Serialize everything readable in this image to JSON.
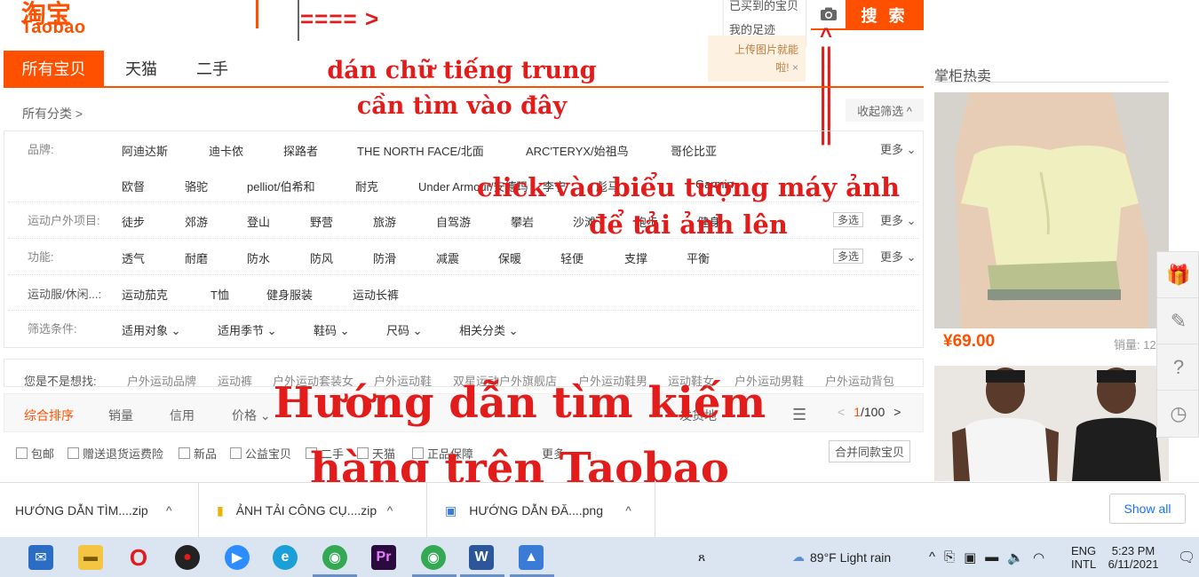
{
  "header": {
    "logo_cn": "淘宝",
    "logo_en": "Taobao",
    "history_items": [
      "已买到的宝贝",
      "我的足迹"
    ],
    "tip_line1": "上传图片就能",
    "tip_line2": "啦!",
    "tip_close": "×",
    "search_button": "搜 索",
    "annotation_arrow": "==== >"
  },
  "tabs": [
    "所有宝贝",
    "天猫",
    "二手"
  ],
  "categories": {
    "title": "所有分类 >",
    "collapse": "收起筛选 ^"
  },
  "filters": {
    "brand_label": "品牌:",
    "brands_row1": [
      "阿迪达斯",
      "迪卡侬",
      "探路者",
      "THE NORTH FACE/北面",
      "ARC'TERYX/始祖鸟",
      "哥伦比亚"
    ],
    "brands_row2": [
      "欧督",
      "骆驼",
      "pelliot/伯希和",
      "耐克",
      "Under Armour/安德玛",
      "李宁",
      "彪马",
      "Garmin"
    ],
    "sport_label": "运动户外项目:",
    "sports": [
      "徒步",
      "郊游",
      "登山",
      "野营",
      "旅游",
      "自驾游",
      "攀岩",
      "沙滩",
      "跑步",
      "健身"
    ],
    "func_label": "功能:",
    "funcs": [
      "透气",
      "耐磨",
      "防水",
      "防风",
      "防滑",
      "减震",
      "保暖",
      "轻便",
      "支撑",
      "平衡"
    ],
    "cloth_label": "运动服/休闲...:",
    "cloths": [
      "运动茄克",
      "T恤",
      "健身服装",
      "运动长裤"
    ],
    "cond_label": "筛选条件:",
    "conds": [
      "适用对象",
      "适用季节",
      "鞋码",
      "尺码",
      "相关分类"
    ],
    "multi": "多选",
    "more": "更多"
  },
  "related": {
    "label": "您是不是想找:",
    "items": [
      "户外运动品牌",
      "运动裤",
      "户外运动套装女",
      "户外运动鞋",
      "双星运动户外旗舰店",
      "户外运动鞋男",
      "运动鞋女",
      "户外运动男鞋",
      "户外运动背包"
    ]
  },
  "sortbar": {
    "items": [
      "综合排序",
      "销量",
      "信用",
      "价格"
    ],
    "page": "1",
    "total": "/100",
    "location": "发货地"
  },
  "checks": [
    "包邮",
    "赠送退货运费险",
    "新品",
    "公益宝贝",
    "二手",
    "天猫",
    "正品保障"
  ],
  "checks_more": "更多",
  "merge": "合并同款宝贝",
  "sidebar": {
    "title": "掌柜热卖",
    "price": "¥69.00",
    "sales": "销量: 12"
  },
  "overlays": {
    "paste_line1": "dán chữ tiếng trung",
    "paste_line2": "cần tìm vào đây",
    "camera_line1": "click vào biểu tượng máy ảnh",
    "camera_line2": "để tải ảnh lên",
    "main_line1": "Hướng dẫn tìm kiếm",
    "main_line2": "hàng trên Taobao"
  },
  "downloads": {
    "items": [
      "HƯỚNG DẪN TÌM....zip",
      "ẢNH TẢI CÔNG CỤ....zip",
      "HƯỚNG DẪN ĐĂ....png"
    ],
    "show_all": "Show all"
  },
  "taskbar": {
    "weather": "89°F  Light rain",
    "lang1": "ENG",
    "lang2": "INTL",
    "time": "5:23 PM",
    "date": "6/11/2021"
  }
}
